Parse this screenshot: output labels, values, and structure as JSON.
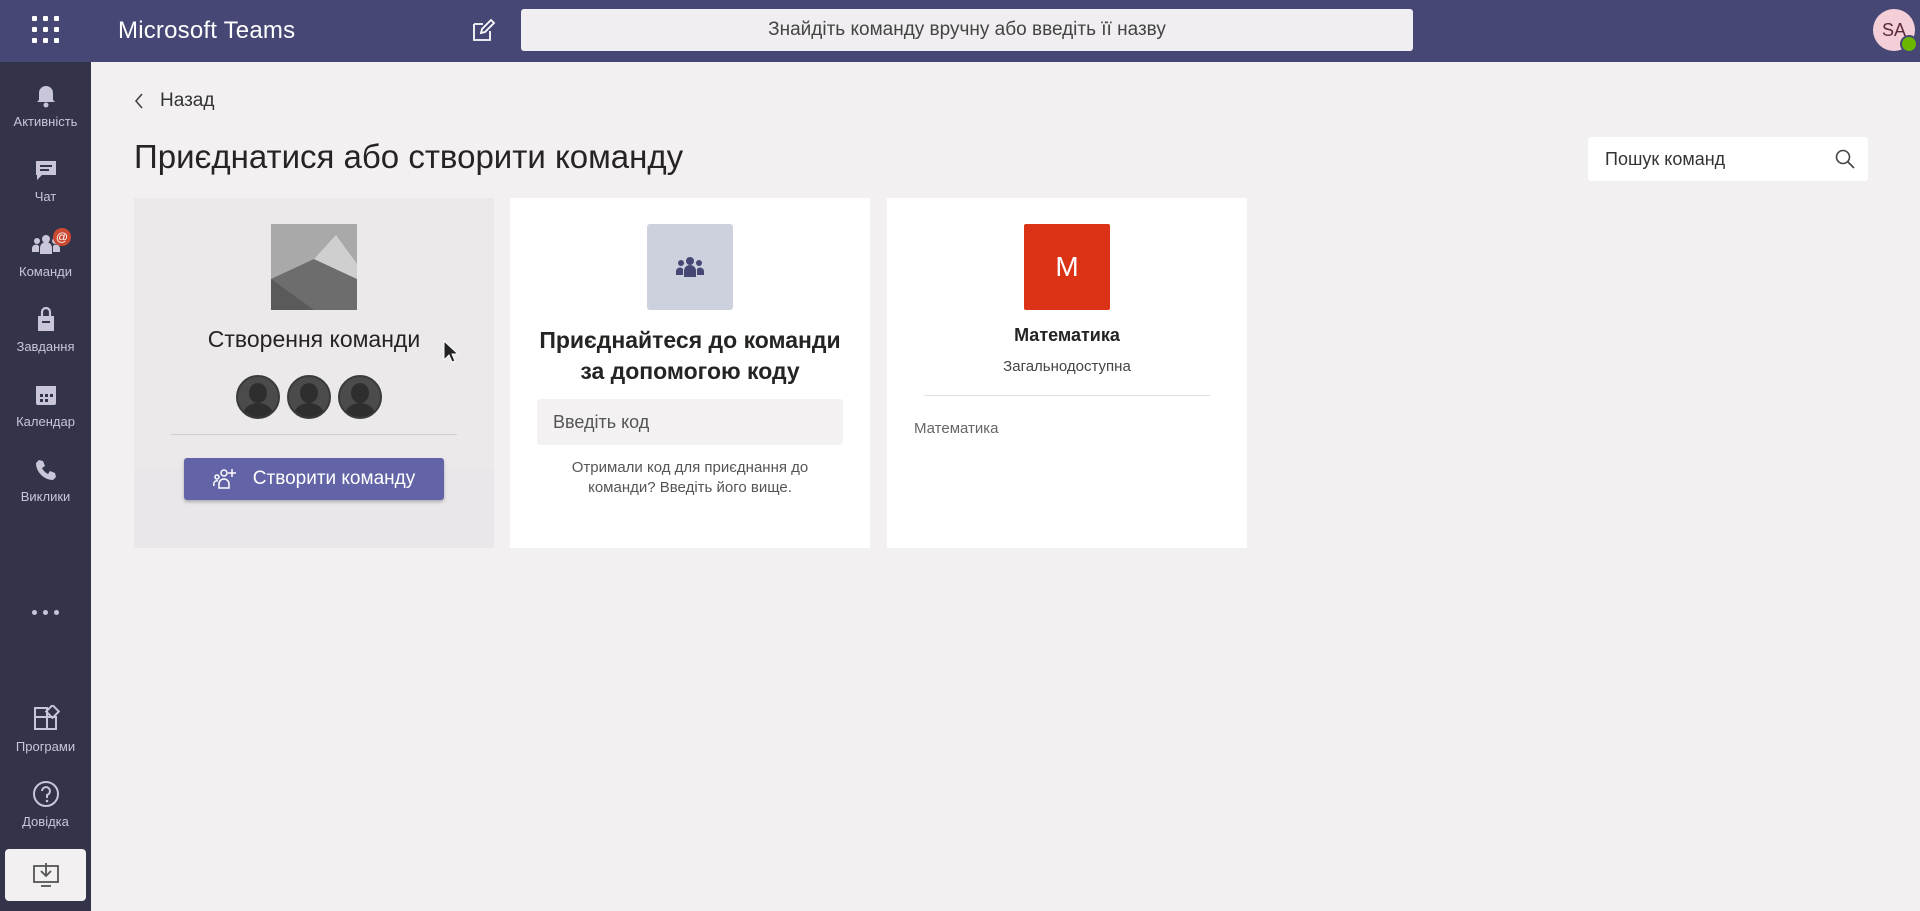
{
  "topbar": {
    "app_title": "Microsoft Teams",
    "search_placeholder": "Знайдіть команду вручну або введіть її назву",
    "avatar_initials": "SA"
  },
  "rail": {
    "items": [
      {
        "label": "Активність",
        "icon": "bell-icon"
      },
      {
        "label": "Чат",
        "icon": "chat-icon"
      },
      {
        "label": "Команди",
        "icon": "teams-icon",
        "badge": "@"
      },
      {
        "label": "Завдання",
        "icon": "assignments-icon"
      },
      {
        "label": "Календар",
        "icon": "calendar-icon"
      },
      {
        "label": "Виклики",
        "icon": "phone-icon"
      }
    ],
    "bottom": [
      {
        "label": "Програми",
        "icon": "apps-icon"
      },
      {
        "label": "Довідка",
        "icon": "help-icon"
      }
    ]
  },
  "main": {
    "back_label": "Назад",
    "title": "Приєднатися або створити команду",
    "team_search_placeholder": "Пошук команд"
  },
  "cards": {
    "create": {
      "title": "Створення команди",
      "button_label": "Створити команду"
    },
    "join": {
      "title_line1": "Приєднайтеся до команди",
      "title_line2": "за допомогою коду",
      "input_placeholder": "Введіть код",
      "hint": "Отримали код для приєднання до команди? Введіть його вище."
    },
    "team": {
      "initial": "M",
      "name": "Математика",
      "visibility": "Загальнодоступна",
      "description": "Математика"
    }
  },
  "colors": {
    "topbar": "#464775",
    "rail": "#33344a",
    "accent": "#6264a7",
    "team_tile": "#dc3317",
    "background": "#f3f0f2"
  }
}
